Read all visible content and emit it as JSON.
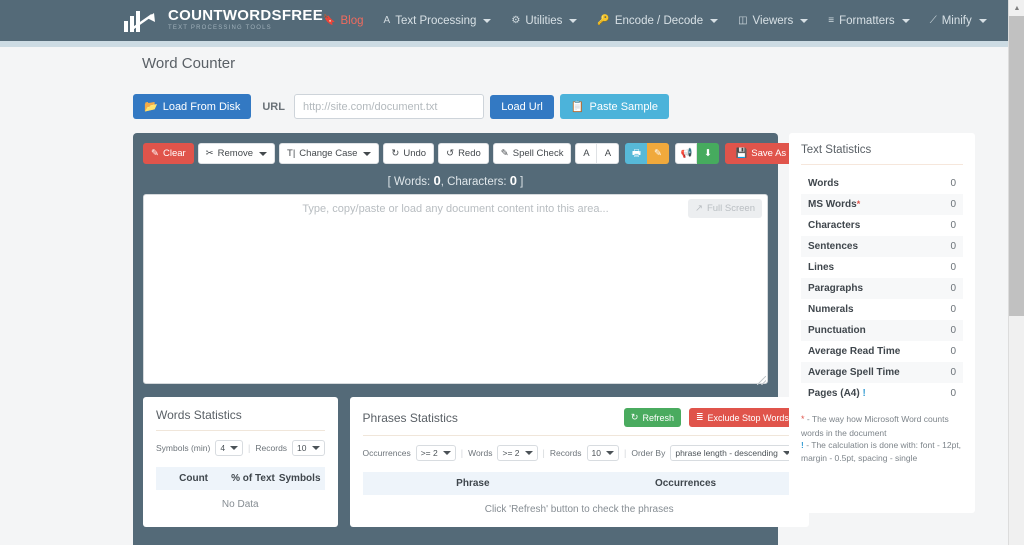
{
  "navbar": {
    "brand_name": "COUNTWORDSFREE",
    "brand_tagline": "TEXT PROCESSING TOOLS",
    "items": [
      {
        "label": "Blog",
        "icon": "bookmark-icon",
        "caret": false
      },
      {
        "label": "Text Processing",
        "icon": "font-icon",
        "caret": true
      },
      {
        "label": "Utilities",
        "icon": "gear-icon",
        "caret": true
      },
      {
        "label": "Encode / Decode",
        "icon": "key-icon",
        "caret": true
      },
      {
        "label": "Viewers",
        "icon": "columns-icon",
        "caret": true
      },
      {
        "label": "Formatters",
        "icon": "align-center-icon",
        "caret": true
      },
      {
        "label": "Minify",
        "icon": "compress-icon",
        "caret": true
      }
    ]
  },
  "page": {
    "title": "Word Counter"
  },
  "urlbar": {
    "load_from_disk": "Load From Disk",
    "url_label": "URL",
    "url_placeholder": "http://site.com/document.txt",
    "url_value": "",
    "load_url": "Load Url",
    "paste_sample": "Paste Sample"
  },
  "toolbar": {
    "clear": "Clear",
    "remove": "Remove",
    "change_case": "Change Case",
    "undo": "Undo",
    "redo": "Redo",
    "spell_check": "Spell Check",
    "font_increase": "A",
    "font_decrease": "A",
    "print": "print-icon",
    "highlight": "highlight-icon",
    "announce": "megaphone-icon",
    "download": "download-icon",
    "save_as": "Save As"
  },
  "counts": {
    "prefix": "[ Words:",
    "words": "0",
    "middle": ", Characters:",
    "characters": "0",
    "suffix": "]"
  },
  "editor": {
    "placeholder": "Type, copy/paste or load any document content into this area...",
    "value": "",
    "full_screen": "Full Screen"
  },
  "words_statistics": {
    "title": "Words Statistics",
    "symbols_min_label": "Symbols (min)",
    "symbols_min_value": "4",
    "records_label": "Records",
    "records_value": "10",
    "columns": [
      "Count",
      "% of Text",
      "Symbols"
    ],
    "empty_message": "No Data"
  },
  "phrases_statistics": {
    "title": "Phrases Statistics",
    "refresh": "Refresh",
    "exclude_stop_words": "Exclude Stop Words",
    "occurrences_label": "Occurrences",
    "occurrences_value": ">= 2",
    "words_label": "Words",
    "words_value": ">= 2",
    "records_label": "Records",
    "records_value": "10",
    "order_by_label": "Order By",
    "order_by_value": "phrase length - descending",
    "columns": [
      "Phrase",
      "Occurrences"
    ],
    "empty_message": "Click 'Refresh' button to check the phrases"
  },
  "text_statistics": {
    "title": "Text Statistics",
    "rows": [
      {
        "label": "Words",
        "value": "0",
        "marker": ""
      },
      {
        "label": "MS Words",
        "value": "0",
        "marker": "*"
      },
      {
        "label": "Characters",
        "value": "0",
        "marker": ""
      },
      {
        "label": "Sentences",
        "value": "0",
        "marker": ""
      },
      {
        "label": "Lines",
        "value": "0",
        "marker": ""
      },
      {
        "label": "Paragraphs",
        "value": "0",
        "marker": ""
      },
      {
        "label": "Numerals",
        "value": "0",
        "marker": ""
      },
      {
        "label": "Punctuation",
        "value": "0",
        "marker": ""
      },
      {
        "label": "Average Read Time",
        "value": "0",
        "marker": ""
      },
      {
        "label": "Average Spell Time",
        "value": "0",
        "marker": ""
      },
      {
        "label": "Pages (A4)",
        "value": "0",
        "marker": "!"
      }
    ],
    "note_asterisk": "- The way how Microsoft Word counts words in the document",
    "note_bang": "- The calculation is done with: font - 12pt, margin - 0.5pt, spacing - single"
  },
  "colors": {
    "header": "#546a78",
    "accent_blue": "#3379c3",
    "accent_light_blue": "#4cb3da",
    "danger": "#e0544b",
    "success": "#4aab5f",
    "warning": "#f0a93c",
    "info": "#57b9d8"
  }
}
